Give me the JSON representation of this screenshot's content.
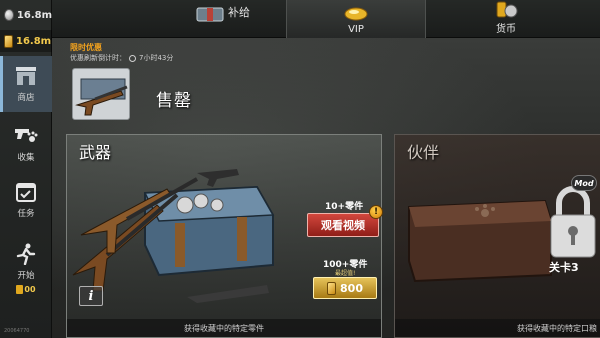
{
  "resources": {
    "silver": "16.8m",
    "gold": "16.8m"
  },
  "sidebar": {
    "items": [
      {
        "label": "商店",
        "icon": "shop-icon",
        "active": true
      },
      {
        "label": "收集",
        "icon": "gun-pawprint-icon",
        "active": false
      },
      {
        "label": "任务",
        "icon": "calendar-check-icon",
        "active": false
      },
      {
        "label": "开始",
        "icon": "running-man-icon",
        "active": false
      }
    ],
    "start_cost": "00",
    "version": "20064770"
  },
  "tabs": [
    {
      "label": "补给",
      "icon": "supply-chest-icon"
    },
    {
      "label": "VIP",
      "icon": "vip-gold-icon"
    },
    {
      "label": "货币",
      "icon": "currency-icon"
    }
  ],
  "promo": {
    "heading": "限时优惠",
    "timer_label": "优惠刷新倒计时：",
    "timer_value": "7小时43分",
    "soldout": "售罄"
  },
  "weapon_card": {
    "title": "武器",
    "info": "i",
    "offer1_parts": "10+零件",
    "offer1_button": "观看视频",
    "offer2_parts": "100+零件",
    "offer2_tag": "最超值!",
    "offer2_price": "800",
    "footer": "获得收藏中的特定零件"
  },
  "partner_card": {
    "title": "伙伴",
    "mod_badge": "Mod",
    "lock_label": "关卡3",
    "footer": "获得收藏中的特定口粮"
  },
  "colors": {
    "gold": "#f2c94c",
    "promo_orange": "#f2a21e",
    "watch_red": "#c0392b",
    "active_nav": "#3e4b56"
  }
}
